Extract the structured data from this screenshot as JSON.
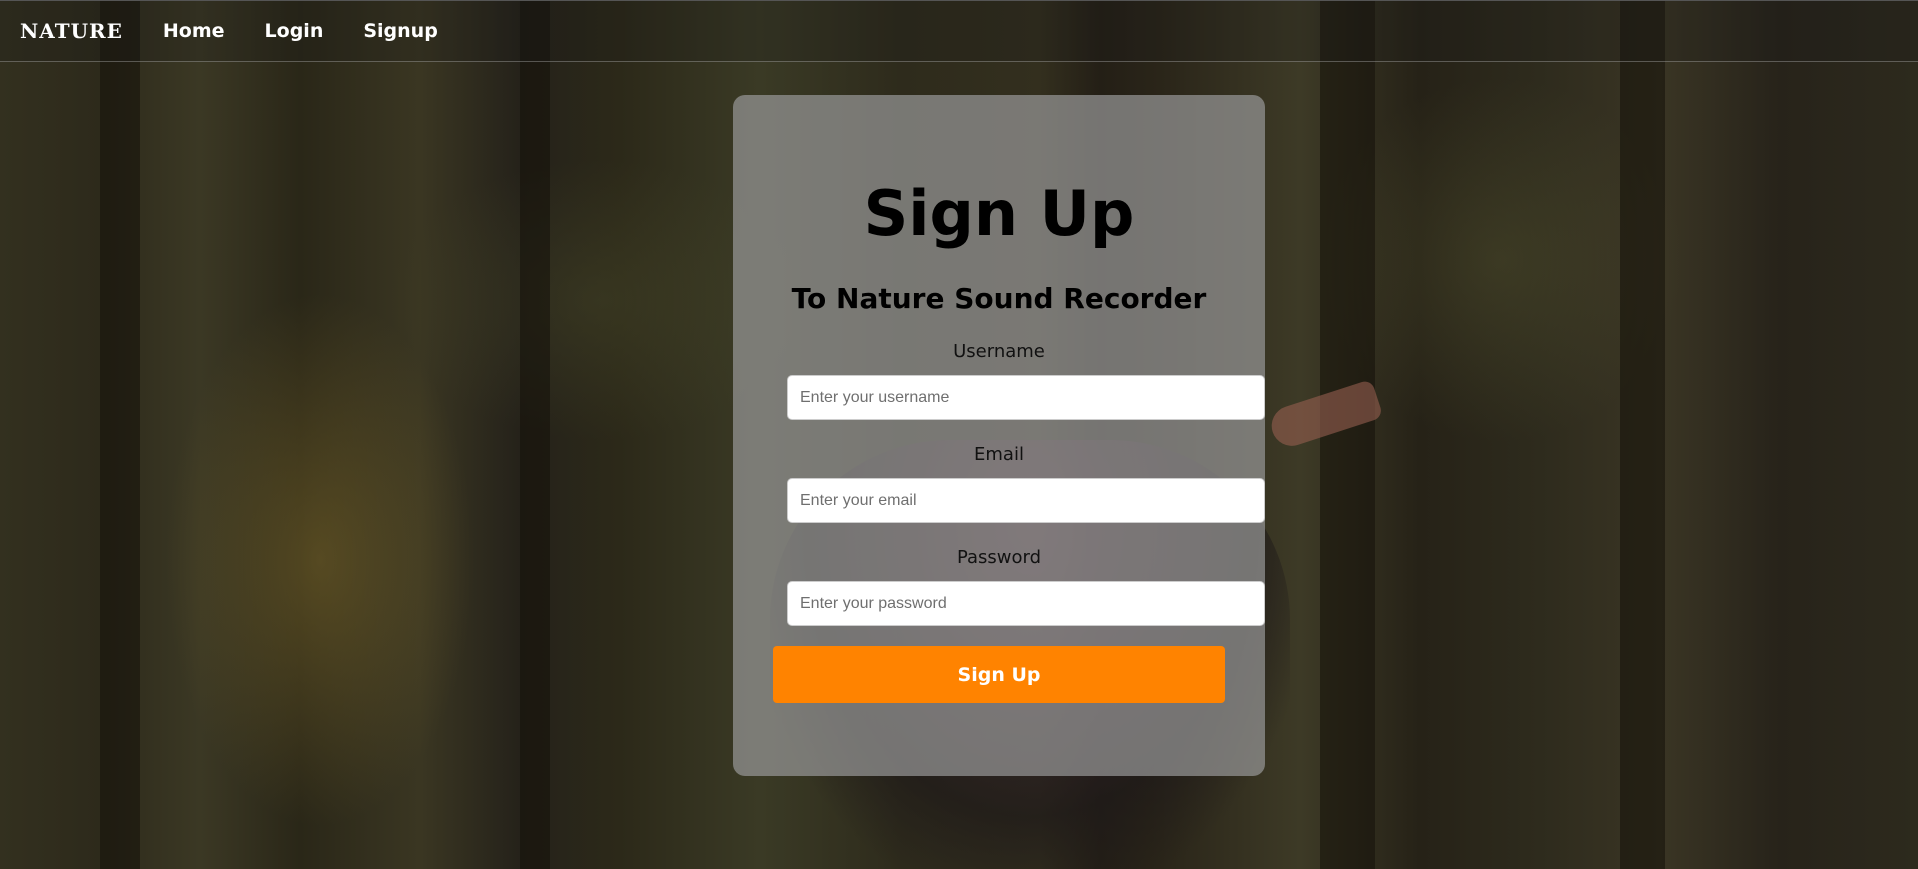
{
  "nav": {
    "brand": "NATURE",
    "links": [
      "Home",
      "Login",
      "Signup"
    ]
  },
  "form": {
    "title": "Sign Up",
    "subtitle": "To Nature Sound Recorder",
    "username_label": "Username",
    "username_placeholder": "Enter your username",
    "email_label": "Email",
    "email_placeholder": "Enter your email",
    "password_label": "Password",
    "password_placeholder": "Enter your password",
    "submit_label": "Sign Up"
  },
  "colors": {
    "accent": "#ff8300",
    "card": "rgba(150,150,150,0.72)"
  }
}
